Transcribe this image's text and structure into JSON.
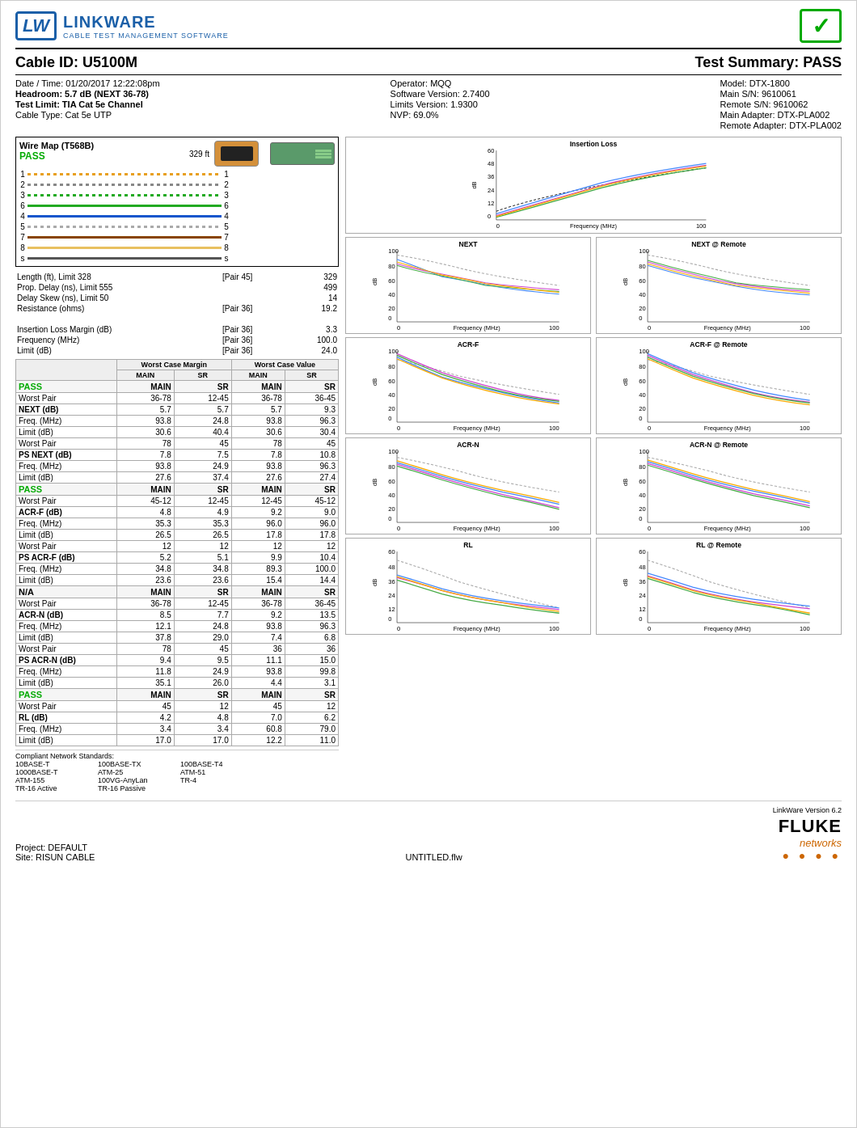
{
  "header": {
    "logo_lw": "LW",
    "logo_name": "LINKWARE",
    "logo_subtitle": "CABLE TEST MANAGEMENT SOFTWARE",
    "checkmark": "✓"
  },
  "cable_id_label": "Cable ID: U5100M",
  "test_summary_label": "Test Summary: PASS",
  "info": {
    "datetime": "Date / Time: 01/20/2017 12:22:08pm",
    "headroom_label": "Headroom: 5.7 dB (NEXT 36-78)",
    "test_limit": "Test Limit: TIA Cat 5e Channel",
    "cable_type": "Cable Type: Cat 5e UTP",
    "operator": "Operator: MQQ",
    "software": "Software Version: 2.7400",
    "limits": "Limits Version: 1.9300",
    "nvp": "NVP: 69.0%",
    "model": "Model: DTX-1800",
    "main_sn": "Main S/N: 9610061",
    "remote_sn": "Remote S/N: 9610062",
    "main_adapter": "Main Adapter: DTX-PLA002",
    "remote_adapter": "Remote Adapter: DTX-PLA002"
  },
  "wire_map": {
    "title": "Wire Map (T568B)",
    "status": "PASS",
    "pins": [
      {
        "left": "1",
        "right": "1",
        "color": "#e8a020"
      },
      {
        "left": "2",
        "right": "2",
        "color": "#cccccc"
      },
      {
        "left": "3",
        "right": "3",
        "color": "#22aa22"
      },
      {
        "left": "6",
        "right": "6",
        "color": "#22aa22"
      },
      {
        "left": "4",
        "right": "4",
        "color": "#1155cc"
      },
      {
        "left": "5",
        "right": "5",
        "color": "#cccccc"
      },
      {
        "left": "7",
        "right": "7",
        "color": "#884400"
      },
      {
        "left": "8",
        "right": "8",
        "color": "#884400"
      },
      {
        "left": "s",
        "right": "s",
        "color": "#555555"
      }
    ],
    "length_ft": "329 ft"
  },
  "measurements": {
    "rows": [
      {
        "label": "Length (ft), Limit 328",
        "pair": "[Pair 45]",
        "value": "329"
      },
      {
        "label": "Prop. Delay (ns), Limit 555",
        "pair": "",
        "value": "499"
      },
      {
        "label": "Delay Skew (ns), Limit 50",
        "pair": "",
        "value": "14"
      },
      {
        "label": "Resistance (ohms)",
        "pair": "[Pair 36]",
        "value": "19.2"
      },
      {
        "label": "",
        "pair": "",
        "value": ""
      },
      {
        "label": "Insertion Loss Margin (dB)",
        "pair": "[Pair 36]",
        "value": "3.3"
      },
      {
        "label": "Frequency (MHz)",
        "pair": "[Pair 36]",
        "value": "100.0"
      },
      {
        "label": "Limit (dB)",
        "pair": "[Pair 36]",
        "value": "24.0"
      }
    ]
  },
  "results": [
    {
      "status": "PASS",
      "status_type": "pass",
      "rows": [
        {
          "label": "Worst Pair",
          "main_wcm": "36-78",
          "sr_wcm": "12-45",
          "main_wcv": "36-78",
          "sr_wcv": "36-45"
        },
        {
          "label": "NEXT (dB)",
          "bold": true,
          "main_wcm": "5.7",
          "sr_wcm": "5.7",
          "main_wcv": "5.7",
          "sr_wcv": "9.3"
        },
        {
          "label": "Freq. (MHz)",
          "main_wcm": "93.8",
          "sr_wcm": "24.8",
          "main_wcv": "93.8",
          "sr_wcv": "96.3"
        },
        {
          "label": "Limit (dB)",
          "main_wcm": "30.6",
          "sr_wcm": "40.4",
          "main_wcv": "30.6",
          "sr_wcv": "30.4"
        },
        {
          "label": "Worst Pair",
          "main_wcm": "78",
          "sr_wcm": "45",
          "main_wcv": "78",
          "sr_wcv": "45"
        },
        {
          "label": "PS NEXT (dB)",
          "bold": true,
          "main_wcm": "7.8",
          "sr_wcm": "7.5",
          "main_wcv": "7.8",
          "sr_wcv": "10.8"
        },
        {
          "label": "Freq. (MHz)",
          "main_wcm": "93.8",
          "sr_wcm": "24.9",
          "main_wcv": "93.8",
          "sr_wcv": "96.3"
        },
        {
          "label": "Limit (dB)",
          "main_wcm": "27.6",
          "sr_wcm": "37.4",
          "main_wcv": "27.6",
          "sr_wcv": "27.4"
        }
      ]
    },
    {
      "status": "PASS",
      "status_type": "pass",
      "rows": [
        {
          "label": "Worst Pair",
          "main_wcm": "45-12",
          "sr_wcm": "12-45",
          "main_wcv": "12-45",
          "sr_wcv": "45-12"
        },
        {
          "label": "ACR-F (dB)",
          "bold": true,
          "main_wcm": "4.8",
          "sr_wcm": "4.9",
          "main_wcv": "9.2",
          "sr_wcv": "9.0"
        },
        {
          "label": "Freq. (MHz)",
          "main_wcm": "35.3",
          "sr_wcm": "35.3",
          "main_wcv": "96.0",
          "sr_wcv": "96.0"
        },
        {
          "label": "Limit (dB)",
          "main_wcm": "26.5",
          "sr_wcm": "26.5",
          "main_wcv": "17.8",
          "sr_wcv": "17.8"
        },
        {
          "label": "Worst Pair",
          "main_wcm": "12",
          "sr_wcm": "12",
          "main_wcv": "12",
          "sr_wcv": "12"
        },
        {
          "label": "PS ACR-F (dB)",
          "bold": true,
          "main_wcm": "5.2",
          "sr_wcm": "5.1",
          "main_wcv": "9.9",
          "sr_wcv": "10.4"
        },
        {
          "label": "Freq. (MHz)",
          "main_wcm": "34.8",
          "sr_wcm": "34.8",
          "main_wcv": "89.3",
          "sr_wcv": "100.0"
        },
        {
          "label": "Limit (dB)",
          "main_wcm": "23.6",
          "sr_wcm": "23.6",
          "main_wcv": "15.4",
          "sr_wcv": "14.4"
        }
      ]
    },
    {
      "status": "N/A",
      "status_type": "na",
      "rows": [
        {
          "label": "Worst Pair",
          "main_wcm": "36-78",
          "sr_wcm": "12-45",
          "main_wcv": "36-78",
          "sr_wcv": "36-45"
        },
        {
          "label": "ACR-N (dB)",
          "bold": true,
          "main_wcm": "8.5",
          "sr_wcm": "7.7",
          "main_wcv": "9.2",
          "sr_wcv": "13.5"
        },
        {
          "label": "Freq. (MHz)",
          "main_wcm": "12.1",
          "sr_wcm": "24.8",
          "main_wcv": "93.8",
          "sr_wcv": "96.3"
        },
        {
          "label": "Limit (dB)",
          "main_wcm": "37.8",
          "sr_wcm": "29.0",
          "main_wcv": "7.4",
          "sr_wcv": "6.8"
        },
        {
          "label": "Worst Pair",
          "main_wcm": "78",
          "sr_wcm": "45",
          "main_wcv": "36",
          "sr_wcv": "36"
        },
        {
          "label": "PS ACR-N (dB)",
          "bold": true,
          "main_wcm": "9.4",
          "sr_wcm": "9.5",
          "main_wcv": "11.1",
          "sr_wcv": "15.0"
        },
        {
          "label": "Freq. (MHz)",
          "main_wcm": "11.8",
          "sr_wcm": "24.9",
          "main_wcv": "93.8",
          "sr_wcv": "99.8"
        },
        {
          "label": "Limit (dB)",
          "main_wcm": "35.1",
          "sr_wcm": "26.0",
          "main_wcv": "4.4",
          "sr_wcv": "3.1"
        }
      ]
    },
    {
      "status": "PASS",
      "status_type": "pass",
      "rows": [
        {
          "label": "Worst Pair",
          "main_wcm": "45",
          "sr_wcm": "12",
          "main_wcv": "45",
          "sr_wcv": "12"
        },
        {
          "label": "RL (dB)",
          "bold": true,
          "main_wcm": "4.2",
          "sr_wcm": "4.8",
          "main_wcv": "7.0",
          "sr_wcv": "6.2"
        },
        {
          "label": "Freq. (MHz)",
          "main_wcm": "3.4",
          "sr_wcm": "3.4",
          "main_wcv": "60.8",
          "sr_wcv": "79.0"
        },
        {
          "label": "Limit (dB)",
          "main_wcm": "17.0",
          "sr_wcm": "17.0",
          "main_wcv": "12.2",
          "sr_wcv": "11.0"
        }
      ]
    }
  ],
  "charts": {
    "insertion_loss": {
      "title": "Insertion Loss",
      "x_label": "Frequency (MHz)",
      "x_max": "100",
      "y_label": "dB",
      "y_max": "60",
      "y_ticks": [
        "60",
        "48",
        "36",
        "24",
        "12",
        "0"
      ]
    },
    "next_main": {
      "title": "NEXT",
      "x_label": "Frequency (MHz)",
      "x_max": "100",
      "y_label": "dB",
      "y_max": "100",
      "y_ticks": [
        "100",
        "80",
        "60",
        "40",
        "20",
        "0"
      ]
    },
    "next_remote": {
      "title": "NEXT @ Remote",
      "x_label": "Frequency (MHz)",
      "x_max": "100",
      "y_label": "dB",
      "y_max": "100",
      "y_ticks": [
        "100",
        "80",
        "60",
        "40",
        "20",
        "0"
      ]
    },
    "acrf_main": {
      "title": "ACR-F",
      "x_label": "Frequency (MHz)",
      "x_max": "100",
      "y_label": "dB",
      "y_max": "100",
      "y_ticks": [
        "100",
        "80",
        "60",
        "40",
        "20",
        "0"
      ]
    },
    "acrf_remote": {
      "title": "ACR-F @ Remote",
      "x_label": "Frequency (MHz)",
      "x_max": "100",
      "y_label": "dB",
      "y_max": "100",
      "y_ticks": [
        "100",
        "80",
        "60",
        "40",
        "20",
        "0"
      ]
    },
    "acrn_main": {
      "title": "ACR-N",
      "x_label": "Frequency (MHz)",
      "x_max": "100",
      "y_label": "dB",
      "y_max": "100",
      "y_ticks": [
        "100",
        "80",
        "60",
        "40",
        "20",
        "0"
      ]
    },
    "acrn_remote": {
      "title": "ACR-N @ Remote",
      "x_label": "Frequency (MHz)",
      "x_max": "100",
      "y_label": "dB",
      "y_max": "100",
      "y_ticks": [
        "100",
        "80",
        "60",
        "40",
        "20",
        "0"
      ]
    },
    "rl_main": {
      "title": "RL",
      "x_label": "Frequency (MHz)",
      "x_max": "100",
      "y_label": "dB",
      "y_max": "60",
      "y_ticks": [
        "60",
        "48",
        "36",
        "24",
        "12",
        "0"
      ]
    },
    "rl_remote": {
      "title": "RL @ Remote",
      "x_label": "Frequency (MHz)",
      "x_max": "100",
      "y_label": "dB",
      "y_max": "60",
      "y_ticks": [
        "60",
        "48",
        "36",
        "24",
        "12",
        "0"
      ]
    }
  },
  "standards": {
    "title": "Compliant Network Standards:",
    "items": [
      "10BASE-T",
      "100BASE-TX",
      "100BASE-T4",
      "1000BASE-T",
      "ATM-25",
      "ATM-51",
      "ATM-155",
      "100VG-AnyLan",
      "TR-4",
      "TR-16 Active",
      "TR-16 Passive"
    ]
  },
  "footer": {
    "project": "Project: DEFAULT",
    "site": "Site: RISUN CABLE",
    "filename": "UNTITLED.flw",
    "linkware_version": "LinkWare Version 6.2",
    "fluke": "FLUKE",
    "networks": "networks",
    "dots": "● ● ● ●"
  },
  "table_headers": {
    "worst_case_margin": "Worst Case Margin",
    "worst_case_value": "Worst Case Value",
    "main": "MAIN",
    "sr": "SR"
  }
}
